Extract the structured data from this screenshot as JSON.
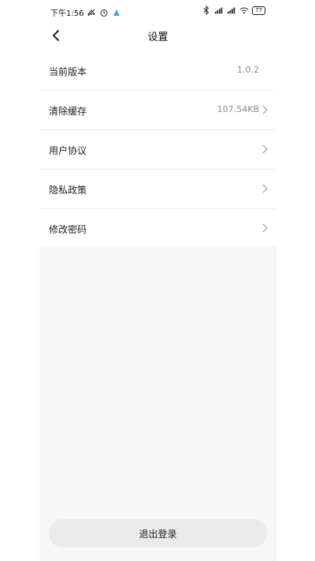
{
  "status_bar": {
    "time": "下午1:56",
    "battery": "77"
  },
  "header": {
    "title": "设置"
  },
  "settings": {
    "items": [
      {
        "label": "当前版本",
        "value": "1.0.2"
      },
      {
        "label": "清除缓存",
        "value": "107.54KB"
      },
      {
        "label": "用户协议",
        "value": ""
      },
      {
        "label": "隐私政策",
        "value": ""
      },
      {
        "label": "修改密码",
        "value": ""
      }
    ]
  },
  "logout": {
    "label": "退出登录"
  },
  "colors": {
    "page_bg": "#f7f7f7",
    "button_bg": "#ebebeb",
    "secondary_text": "#8a8a8a"
  }
}
